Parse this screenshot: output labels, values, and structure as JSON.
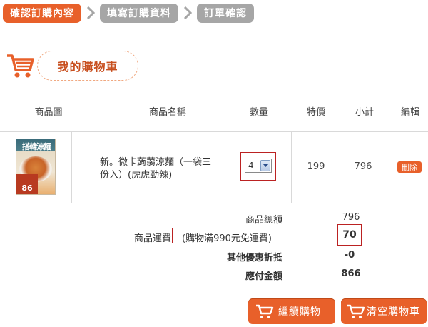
{
  "steps": [
    {
      "label": "確認訂購內容",
      "state": "active"
    },
    {
      "label": "填寫訂購資料",
      "state": "inactive"
    },
    {
      "label": "訂單確認",
      "state": "inactive"
    }
  ],
  "cart": {
    "title": "我的購物車"
  },
  "table": {
    "headers": {
      "image": "商品圖",
      "name": "商品名稱",
      "qty": "數量",
      "price": "特價",
      "subtotal": "小計",
      "edit": "編輯"
    },
    "rows": [
      {
        "name_line1": "新。微卡蒟蒻涼麵（一袋三",
        "name_line2": "份入）(虎虎勁辣)",
        "qty": "4",
        "price": "199",
        "subtotal": "796",
        "delete_label": "刪除",
        "image_top_text": "搭韓涼麵",
        "image_tag_text": "86"
      }
    ]
  },
  "summary": {
    "total_label": "商品總額",
    "total_value": "796",
    "shipping_label": "商品運費",
    "shipping_note": "(購物滿990元免運費)",
    "shipping_value": "70",
    "discount_label": "其他優惠折抵",
    "discount_value": "-0",
    "payable_label": "應付金額",
    "payable_value": "866"
  },
  "buttons": {
    "continue_label": "繼續購物",
    "clear_label": "清空購物車"
  },
  "colors": {
    "accent": "#e8602a",
    "inactive": "#a6a6a6",
    "highlight_box": "#bb2222"
  }
}
